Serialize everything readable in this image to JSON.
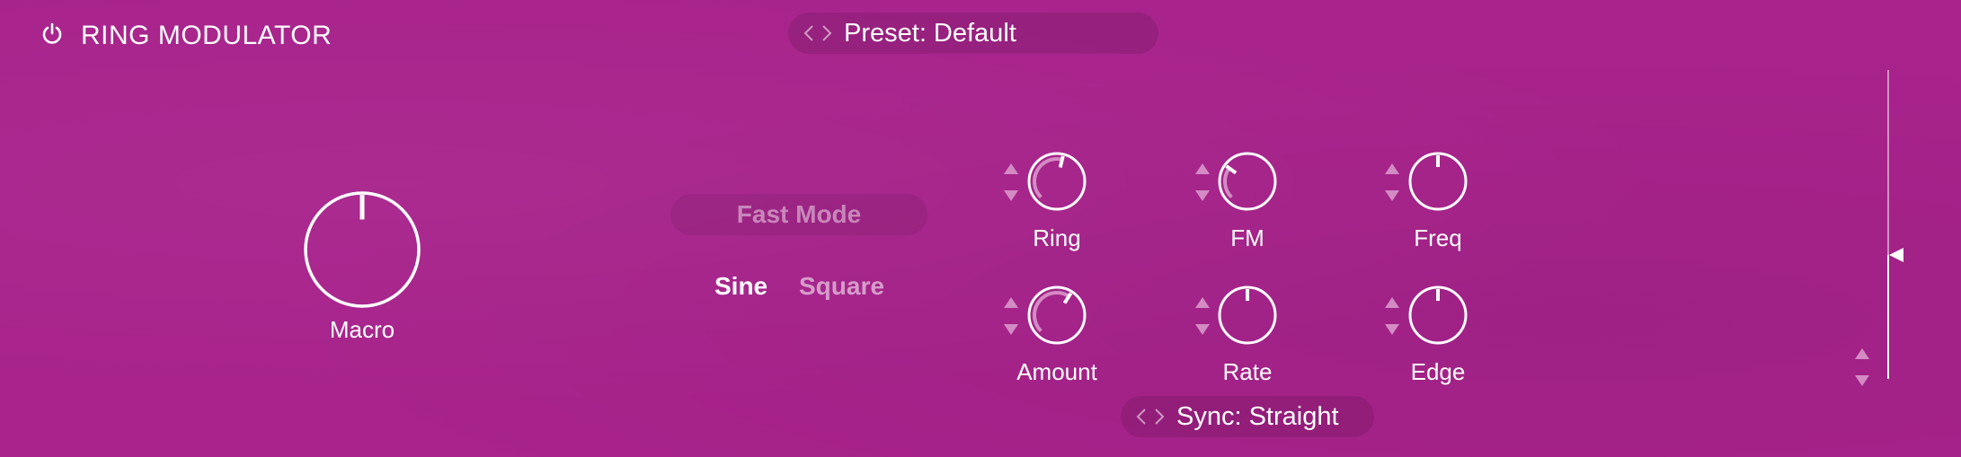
{
  "header": {
    "title": "RING MODULATOR",
    "power_icon": "power-icon"
  },
  "preset": {
    "label": "Preset: Default"
  },
  "macro": {
    "label": "Macro",
    "value": 0.5
  },
  "mode": {
    "fast_mode_label": "Fast Mode",
    "fast_mode_on": false
  },
  "waveform": {
    "options": [
      "Sine",
      "Square"
    ],
    "selected": "Sine"
  },
  "params": {
    "ring": {
      "label": "Ring",
      "value": 0.55
    },
    "fm": {
      "label": "FM",
      "value": 0.3
    },
    "freq": {
      "label": "Freq",
      "value": 0.5
    },
    "amount": {
      "label": "Amount",
      "value": 0.62
    },
    "rate": {
      "label": "Rate",
      "value": 0.5
    },
    "edge": {
      "label": "Edge",
      "value": 0.5
    }
  },
  "sync": {
    "label": "Sync: Straight"
  },
  "output": {
    "level": 0.4
  },
  "colors": {
    "background": "#a8238c",
    "foreground": "#ffffff",
    "inactive": "#d48bc4"
  }
}
